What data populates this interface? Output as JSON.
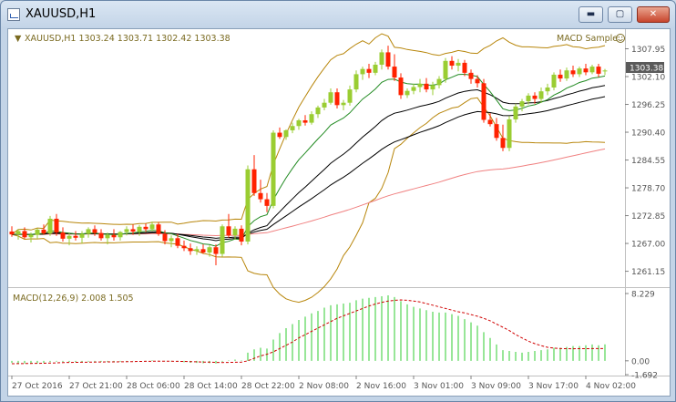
{
  "window": {
    "title": "XAUUSD,H1",
    "min_icon": "minimize-icon",
    "max_icon": "maximize-icon",
    "close_icon": "close-icon"
  },
  "chart": {
    "info_line": "XAUUSD,H1  1303.24 1303.71 1302.42 1303.38",
    "expert_label": "MACD Sample",
    "current_price": "1303.38",
    "macd_label": "MACD(12,26,9) 2.008 1.505"
  },
  "colors": {
    "bull": "#9acd32",
    "bear": "#ff2200",
    "bb": "#b8860b",
    "ma_fast": "#228b22",
    "ma_mid": "#000000",
    "ma_slow": "#f08080",
    "macd_hist": "#32cd32",
    "macd_signal": "#d00000"
  },
  "chart_data": [
    {
      "type": "candlestick",
      "title": "XAUUSD,H1",
      "ylim": [
        1258.0,
        1311.5
      ],
      "y_ticks": [
        "1307.95",
        "1302.10",
        "1296.25",
        "1290.40",
        "1284.55",
        "1278.70",
        "1272.85",
        "1267.00",
        "1261.15"
      ],
      "x_tick_labels": [
        "27 Oct 2016",
        "27 Oct 21:00",
        "28 Oct 06:00",
        "28 Oct 14:00",
        "28 Oct 22:00",
        "2 Nov 08:00",
        "2 Nov 16:00",
        "3 Nov 01:00",
        "3 Nov 09:00",
        "3 Nov 17:00",
        "4 Nov 02:00"
      ],
      "candles_ohlc": [
        [
          1269.5,
          1270.6,
          1268.4,
          1268.9
        ],
        [
          1268.9,
          1270.0,
          1267.8,
          1269.6
        ],
        [
          1269.6,
          1270.4,
          1268.0,
          1268.3
        ],
        [
          1268.3,
          1269.3,
          1267.2,
          1268.8
        ],
        [
          1268.8,
          1270.2,
          1268.0,
          1269.9
        ],
        [
          1269.9,
          1271.0,
          1268.8,
          1269.1
        ],
        [
          1269.1,
          1272.8,
          1268.6,
          1272.2
        ],
        [
          1272.2,
          1273.2,
          1268.6,
          1269.3
        ],
        [
          1269.3,
          1270.4,
          1267.4,
          1268.0
        ],
        [
          1268.0,
          1269.2,
          1266.6,
          1268.6
        ],
        [
          1268.6,
          1269.6,
          1267.6,
          1268.2
        ],
        [
          1268.2,
          1269.6,
          1267.0,
          1269.0
        ],
        [
          1269.0,
          1270.4,
          1268.2,
          1270.0
        ],
        [
          1270.0,
          1270.8,
          1268.6,
          1269.2
        ],
        [
          1269.2,
          1270.0,
          1267.6,
          1268.1
        ],
        [
          1268.1,
          1269.3,
          1266.8,
          1268.8
        ],
        [
          1268.8,
          1270.0,
          1267.6,
          1268.3
        ],
        [
          1268.3,
          1269.6,
          1267.6,
          1269.4
        ],
        [
          1269.4,
          1270.6,
          1268.7,
          1270.0
        ],
        [
          1270.0,
          1271.0,
          1268.8,
          1269.5
        ],
        [
          1269.5,
          1270.9,
          1268.6,
          1270.5
        ],
        [
          1270.5,
          1271.2,
          1269.4,
          1270.0
        ],
        [
          1270.0,
          1271.6,
          1269.6,
          1271.0
        ],
        [
          1271.0,
          1271.5,
          1268.6,
          1269.0
        ],
        [
          1269.0,
          1269.8,
          1266.8,
          1267.5
        ],
        [
          1267.5,
          1268.7,
          1266.2,
          1268.1
        ],
        [
          1268.1,
          1269.0,
          1266.0,
          1266.5
        ],
        [
          1266.5,
          1267.6,
          1265.4,
          1266.0
        ],
        [
          1266.0,
          1267.0,
          1264.6,
          1265.4
        ],
        [
          1265.4,
          1266.4,
          1264.6,
          1265.8
        ],
        [
          1265.8,
          1266.8,
          1264.8,
          1265.1
        ],
        [
          1265.1,
          1266.6,
          1264.2,
          1266.2
        ],
        [
          1266.2,
          1266.8,
          1262.4,
          1264.8
        ],
        [
          1264.8,
          1271.0,
          1264.2,
          1270.6
        ],
        [
          1270.6,
          1273.2,
          1268.2,
          1268.7
        ],
        [
          1268.7,
          1270.6,
          1267.8,
          1270.1
        ],
        [
          1270.1,
          1270.8,
          1266.6,
          1267.4
        ],
        [
          1267.4,
          1283.4,
          1266.8,
          1282.6
        ],
        [
          1282.6,
          1285.6,
          1277.0,
          1277.6
        ],
        [
          1277.6,
          1280.4,
          1275.6,
          1276.3
        ],
        [
          1276.3,
          1277.6,
          1273.6,
          1274.9
        ],
        [
          1274.9,
          1290.8,
          1274.4,
          1290.3
        ],
        [
          1290.3,
          1291.4,
          1289.0,
          1289.4
        ],
        [
          1289.4,
          1291.0,
          1288.8,
          1290.8
        ],
        [
          1290.8,
          1292.4,
          1290.2,
          1291.7
        ],
        [
          1291.7,
          1293.2,
          1290.9,
          1292.9
        ],
        [
          1292.9,
          1294.0,
          1291.8,
          1292.4
        ],
        [
          1292.4,
          1294.8,
          1292.0,
          1294.2
        ],
        [
          1294.2,
          1296.0,
          1293.4,
          1295.6
        ],
        [
          1295.6,
          1297.4,
          1295.0,
          1296.6
        ],
        [
          1296.6,
          1299.6,
          1296.2,
          1298.8
        ],
        [
          1298.8,
          1299.6,
          1295.4,
          1296.1
        ],
        [
          1296.1,
          1297.2,
          1295.0,
          1296.6
        ],
        [
          1296.6,
          1300.2,
          1296.0,
          1299.4
        ],
        [
          1299.4,
          1303.4,
          1298.8,
          1302.6
        ],
        [
          1302.6,
          1304.2,
          1301.4,
          1303.7
        ],
        [
          1303.7,
          1304.8,
          1301.8,
          1302.9
        ],
        [
          1302.9,
          1305.2,
          1302.4,
          1304.6
        ],
        [
          1304.6,
          1307.8,
          1303.6,
          1307.2
        ],
        [
          1307.2,
          1308.6,
          1303.6,
          1304.2
        ],
        [
          1304.2,
          1306.8,
          1301.2,
          1301.9
        ],
        [
          1301.9,
          1302.8,
          1297.4,
          1298.2
        ],
        [
          1298.2,
          1299.6,
          1297.6,
          1299.1
        ],
        [
          1299.1,
          1300.6,
          1298.4,
          1299.9
        ],
        [
          1299.9,
          1301.6,
          1298.8,
          1300.6
        ],
        [
          1300.6,
          1301.8,
          1298.8,
          1299.4
        ],
        [
          1299.4,
          1301.0,
          1298.2,
          1300.3
        ],
        [
          1300.3,
          1302.2,
          1299.6,
          1301.6
        ],
        [
          1301.6,
          1306.0,
          1300.8,
          1305.4
        ],
        [
          1305.4,
          1306.4,
          1303.6,
          1304.4
        ],
        [
          1304.4,
          1305.8,
          1303.2,
          1305.0
        ],
        [
          1305.0,
          1305.6,
          1302.2,
          1302.9
        ],
        [
          1302.9,
          1303.6,
          1300.6,
          1301.6
        ],
        [
          1301.6,
          1302.4,
          1299.8,
          1300.7
        ],
        [
          1300.7,
          1301.6,
          1292.4,
          1293.0
        ],
        [
          1293.0,
          1294.4,
          1291.6,
          1292.1
        ],
        [
          1292.1,
          1293.4,
          1288.6,
          1289.2
        ],
        [
          1289.2,
          1292.0,
          1286.4,
          1287.1
        ],
        [
          1287.1,
          1293.8,
          1286.4,
          1293.1
        ],
        [
          1293.1,
          1296.4,
          1292.4,
          1295.8
        ],
        [
          1295.8,
          1297.4,
          1294.8,
          1296.9
        ],
        [
          1296.9,
          1298.6,
          1296.2,
          1298.1
        ],
        [
          1298.1,
          1298.8,
          1296.4,
          1297.4
        ],
        [
          1297.4,
          1299.8,
          1296.6,
          1299.0
        ],
        [
          1299.0,
          1300.6,
          1298.2,
          1299.8
        ],
        [
          1299.8,
          1303.0,
          1299.2,
          1302.5
        ],
        [
          1302.5,
          1303.6,
          1301.0,
          1301.7
        ],
        [
          1301.7,
          1304.0,
          1301.2,
          1303.4
        ],
        [
          1303.4,
          1304.4,
          1302.0,
          1302.6
        ],
        [
          1302.6,
          1304.2,
          1302.0,
          1303.8
        ],
        [
          1303.8,
          1304.8,
          1302.4,
          1303.0
        ],
        [
          1303.0,
          1304.6,
          1302.6,
          1304.2
        ],
        [
          1304.2,
          1304.8,
          1302.0,
          1302.7
        ],
        [
          1303.24,
          1303.71,
          1302.42,
          1303.38
        ]
      ]
    },
    {
      "type": "bar",
      "title": "MACD(12,26,9) 2.008 1.505",
      "ylim": [
        -1.692,
        8.229
      ],
      "y_ticks": [
        "8.229",
        "0.00",
        "-1.692"
      ],
      "values_macd": [
        -0.25,
        -0.3,
        -0.32,
        -0.3,
        -0.28,
        -0.25,
        -0.15,
        -0.1,
        -0.12,
        -0.14,
        -0.15,
        -0.13,
        -0.1,
        -0.1,
        -0.12,
        -0.12,
        -0.13,
        -0.1,
        -0.06,
        -0.04,
        0.0,
        0.02,
        0.06,
        0.02,
        -0.05,
        -0.08,
        -0.12,
        -0.18,
        -0.24,
        -0.26,
        -0.3,
        -0.28,
        -0.32,
        -0.1,
        0.05,
        0.15,
        0.05,
        1.0,
        1.4,
        1.6,
        1.5,
        2.6,
        3.4,
        4.0,
        4.5,
        5.0,
        5.4,
        5.8,
        6.1,
        6.5,
        6.8,
        6.9,
        7.0,
        7.1,
        7.4,
        7.6,
        7.7,
        7.8,
        7.9,
        8.0,
        7.8,
        7.3,
        6.9,
        6.6,
        6.4,
        6.2,
        6.0,
        5.9,
        5.9,
        5.7,
        5.5,
        5.1,
        4.7,
        4.3,
        3.5,
        2.8,
        2.0,
        1.3,
        1.2,
        1.1,
        1.0,
        1.1,
        1.2,
        1.3,
        1.4,
        1.6,
        1.6,
        1.7,
        1.8,
        1.8,
        1.9,
        2.0,
        1.9,
        2.008
      ],
      "values_signal": [
        -0.35,
        -0.34,
        -0.33,
        -0.32,
        -0.31,
        -0.3,
        -0.28,
        -0.25,
        -0.22,
        -0.2,
        -0.19,
        -0.18,
        -0.16,
        -0.15,
        -0.14,
        -0.13,
        -0.13,
        -0.12,
        -0.11,
        -0.1,
        -0.08,
        -0.06,
        -0.05,
        -0.04,
        -0.04,
        -0.05,
        -0.06,
        -0.08,
        -0.1,
        -0.12,
        -0.15,
        -0.17,
        -0.2,
        -0.21,
        -0.2,
        -0.18,
        -0.16,
        0.0,
        0.3,
        0.6,
        0.8,
        1.1,
        1.5,
        1.9,
        2.3,
        2.8,
        3.2,
        3.6,
        4.0,
        4.4,
        4.8,
        5.2,
        5.5,
        5.8,
        6.1,
        6.4,
        6.7,
        6.95,
        7.15,
        7.3,
        7.4,
        7.45,
        7.4,
        7.3,
        7.2,
        7.0,
        6.8,
        6.6,
        6.4,
        6.2,
        6.0,
        5.85,
        5.65,
        5.45,
        5.2,
        4.9,
        4.5,
        4.1,
        3.7,
        3.2,
        2.8,
        2.4,
        2.1,
        1.85,
        1.65,
        1.55,
        1.5,
        1.48,
        1.47,
        1.48,
        1.49,
        1.5,
        1.5,
        1.505
      ]
    }
  ]
}
